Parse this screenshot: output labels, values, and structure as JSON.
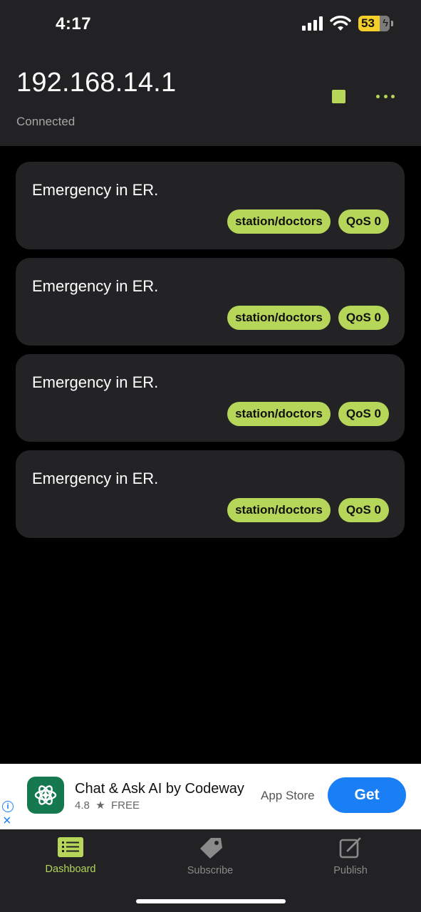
{
  "status_bar": {
    "time": "4:17",
    "battery": "53"
  },
  "header": {
    "host": "192.168.14.1",
    "connection_status": "Connected",
    "stop_icon": "stop-square-icon",
    "menu_icon": "more-horizontal-icon"
  },
  "messages": [
    {
      "text": "Emergency in ER.",
      "topic": "station/doctors",
      "qos": "QoS 0"
    },
    {
      "text": "Emergency in ER.",
      "topic": "station/doctors",
      "qos": "QoS 0"
    },
    {
      "text": "Emergency in ER.",
      "topic": "station/doctors",
      "qos": "QoS 0"
    },
    {
      "text": "Emergency in ER.",
      "topic": "station/doctors",
      "qos": "QoS 0"
    }
  ],
  "ad": {
    "title": "Chat & Ask AI by Codeway",
    "rating": "4.8",
    "price": "FREE",
    "store": "App Store",
    "cta": "Get"
  },
  "tabs": [
    {
      "label": "Dashboard",
      "icon": "dashboard-list-icon"
    },
    {
      "label": "Subscribe",
      "icon": "tag-icon"
    },
    {
      "label": "Publish",
      "icon": "edit-square-icon"
    }
  ],
  "colors": {
    "accent": "#b6d65a",
    "background": "#000000",
    "surface": "#232325",
    "ad_button": "#1a7ff5"
  }
}
